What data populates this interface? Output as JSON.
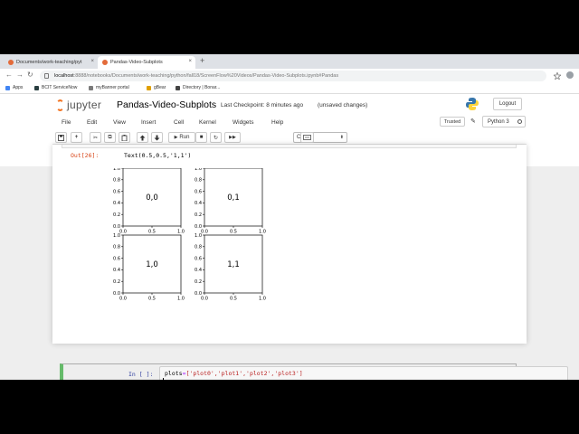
{
  "browser": {
    "tabs": [
      {
        "label": "Documents/work-teaching/pyt",
        "active": false,
        "favicon_color": "#e36b3a"
      },
      {
        "label": "Pandas-Video-Subplots",
        "active": true,
        "favicon_color": "#e36b3a"
      }
    ],
    "new_tab_glyph": "+",
    "close_glyph": "×",
    "address": {
      "host": "localhost",
      "path": ":8888/notebooks/Documents/work-teaching/python/fall18/ScreenFlow%20Videos/Pandas-Video-Subplots.ipynb#Pandas"
    },
    "nav": {
      "back": "←",
      "forward": "→",
      "reload": "↻"
    },
    "bookmarks": [
      {
        "label": "Apps",
        "icon_color": "#4285f4"
      },
      {
        "label": "BCIT ServiceNow",
        "icon_color": "#293e40"
      },
      {
        "label": "myBanner portal",
        "icon_color": "#7a7a7a"
      },
      {
        "label": "gBear",
        "icon_color": "#e0a000"
      },
      {
        "label": "Directory | Bonar...",
        "icon_color": "#444444"
      }
    ]
  },
  "jupyter": {
    "logo_text": "jupyter",
    "notebook_title": "Pandas-Video-Subplots",
    "checkpoint": "Last Checkpoint: 8 minutes ago",
    "unsaved": "(unsaved changes)",
    "logout": "Logout",
    "menu": [
      "File",
      "Edit",
      "View",
      "Insert",
      "Cell",
      "Kernel",
      "Widgets",
      "Help"
    ],
    "trusted": "Trusted",
    "kernel": "Python 3",
    "toolbar": {
      "save_icon": "💾",
      "add_icon": "+",
      "cut_icon": "✂",
      "copy_icon": "⧉",
      "paste_icon": "📋",
      "up_icon": "🡅",
      "down_icon": "🡇",
      "run_icon": "▶",
      "run_label": "Run",
      "stop_icon": "■",
      "restart_icon": "↻",
      "fastforward_icon": "⏩",
      "cell_type": "Code",
      "keyboard_icon": "⌨"
    }
  },
  "output_cell": {
    "prompt": "Out[26]:",
    "text": "Text(0.5,0.5,'1,1')"
  },
  "input_cell": {
    "prompt": "In [ ]:",
    "code_prefix": "plots",
    "code_op": "=",
    "code_rest": "['plot0','plot1','plot2','plot3']",
    "border_color": "#66bb6a"
  },
  "chart_data": [
    {
      "type": "scatter",
      "title": "",
      "annotation": "0,0",
      "xlim": [
        0.0,
        1.0
      ],
      "ylim": [
        0.0,
        1.0
      ],
      "xticks": [
        "0.0",
        "0.5",
        "1.0"
      ],
      "yticks": [
        "0.0",
        "0.2",
        "0.4",
        "0.6",
        "0.8",
        "1.0"
      ],
      "series": []
    },
    {
      "type": "scatter",
      "title": "",
      "annotation": "0,1",
      "xlim": [
        0.0,
        1.0
      ],
      "ylim": [
        0.0,
        1.0
      ],
      "xticks": [
        "0.0",
        "0.5",
        "1.0"
      ],
      "yticks": [
        "0.0",
        "0.2",
        "0.4",
        "0.6",
        "0.8",
        "1.0"
      ],
      "series": []
    },
    {
      "type": "scatter",
      "title": "",
      "annotation": "1,0",
      "xlim": [
        0.0,
        1.0
      ],
      "ylim": [
        0.0,
        1.0
      ],
      "xticks": [
        "0.0",
        "0.5",
        "1.0"
      ],
      "yticks": [
        "0.0",
        "0.2",
        "0.4",
        "0.6",
        "0.8",
        "1.0"
      ],
      "series": []
    },
    {
      "type": "scatter",
      "title": "",
      "annotation": "1,1",
      "xlim": [
        0.0,
        1.0
      ],
      "ylim": [
        0.0,
        1.0
      ],
      "xticks": [
        "0.0",
        "0.5",
        "1.0"
      ],
      "yticks": [
        "0.0",
        "0.2",
        "0.4",
        "0.6",
        "0.8",
        "1.0"
      ],
      "series": []
    }
  ]
}
